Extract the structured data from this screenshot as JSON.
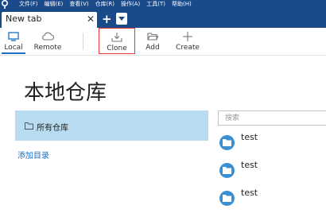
{
  "titlebar": {
    "menu": [
      "文件(F)",
      "编辑(E)",
      "查看(V)",
      "仓库(R)",
      "操作(A)",
      "工具(T)",
      "帮助(H)"
    ]
  },
  "tabs": {
    "active_label": "New tab",
    "close_glyph": "✕",
    "add_glyph": "+"
  },
  "toolbar": {
    "local_label": "Local",
    "remote_label": "Remote",
    "clone_label": "Clone",
    "add_label": "Add",
    "create_label": "Create"
  },
  "main": {
    "title": "本地仓库",
    "group_label": "所有仓库",
    "add_directory": "添加目录",
    "search_placeholder": "搜索",
    "repos": [
      "test",
      "test",
      "test"
    ]
  },
  "colors": {
    "titlebar": "#1a4a8a",
    "accent": "#1a6dc5",
    "selection": "#b8dbef",
    "repo_icon": "#3a8fd3",
    "highlight_border": "#e53935"
  }
}
